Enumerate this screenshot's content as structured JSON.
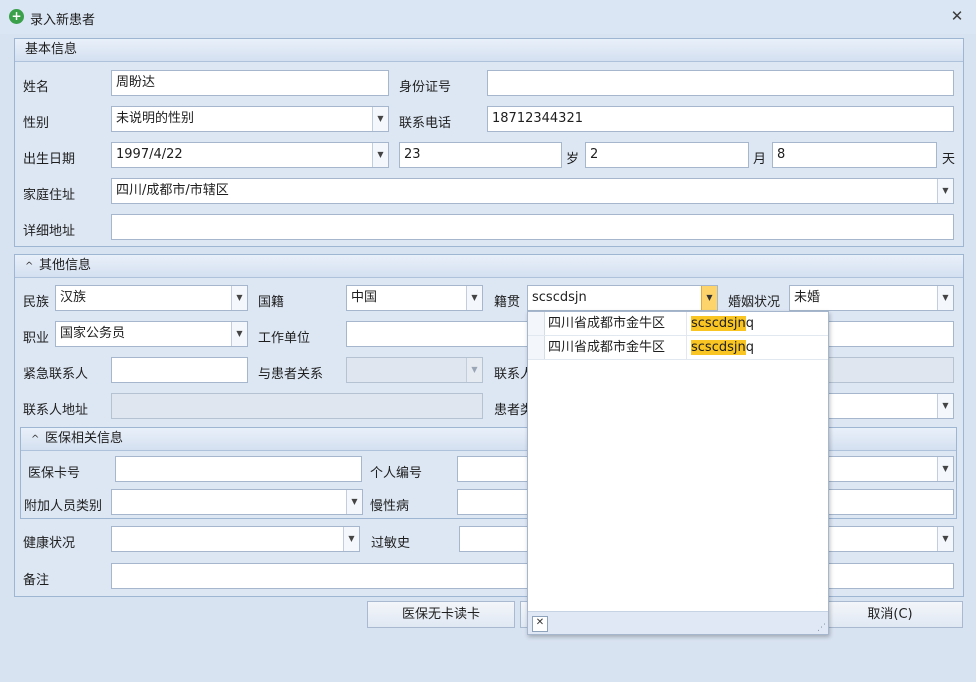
{
  "window": {
    "title": "录入新患者",
    "close_glyph": "✕"
  },
  "basic": {
    "header": "基本信息",
    "name_label": "姓名",
    "name_value": "周盼达",
    "idcard_label": "身份证号",
    "idcard_value": "",
    "gender_label": "性别",
    "gender_value": "未说明的性别",
    "phone_label": "联系电话",
    "phone_value": "18712344321",
    "birth_label": "出生日期",
    "birth_value": "1997/4/22",
    "age_years": "23",
    "age_years_unit": "岁",
    "age_months": "2",
    "age_months_unit": "月",
    "age_days": "8",
    "age_days_unit": "天",
    "home_label": "家庭住址",
    "home_value": "四川/成都市/市辖区",
    "address_label": "详细地址",
    "address_value": ""
  },
  "other": {
    "header": "其他信息",
    "nation_label": "民族",
    "nation_value": "汉族",
    "country_label": "国籍",
    "country_value": "中国",
    "native_label": "籍贯",
    "native_value": "scscdsjn",
    "marital_label": "婚姻状况",
    "marital_value": "未婚",
    "job_label": "职业",
    "job_value": "国家公务员",
    "work_label": "工作单位",
    "work_value": "",
    "emergency_label": "紧急联系人",
    "emergency_value": "",
    "relation_label": "与患者关系",
    "relation_value": "",
    "contact_phone_label": "联系人",
    "contact_addr_label": "联系人地址",
    "contact_addr_value": "",
    "patient_type_label": "患者类"
  },
  "insurance": {
    "header": "医保相关信息",
    "card_label": "医保卡号",
    "card_value": "",
    "personal_label": "个人编号",
    "extra_label": "附加人员类别",
    "extra_value": "",
    "chronic_label": "慢性病"
  },
  "health_label": "健康状况",
  "health_value": "",
  "allergy_label": "过敏史",
  "remark_label": "备注",
  "remark_value": "",
  "buttons": {
    "read_card": "医保无卡读卡",
    "cancel": "取消(C)"
  },
  "popup": {
    "rows": [
      {
        "region": "四川省成都市金牛区",
        "code_match": "scscdsjn",
        "code_rest": "q"
      },
      {
        "region": "四川省成都市金牛区",
        "code_match": "scscdsjn",
        "code_rest": "q"
      }
    ],
    "close_glyph": "✕"
  },
  "colors": {
    "window_bg": "#d8e3f1",
    "highlight": "#f9c523",
    "accent_dropdown": "#fcd46b"
  }
}
